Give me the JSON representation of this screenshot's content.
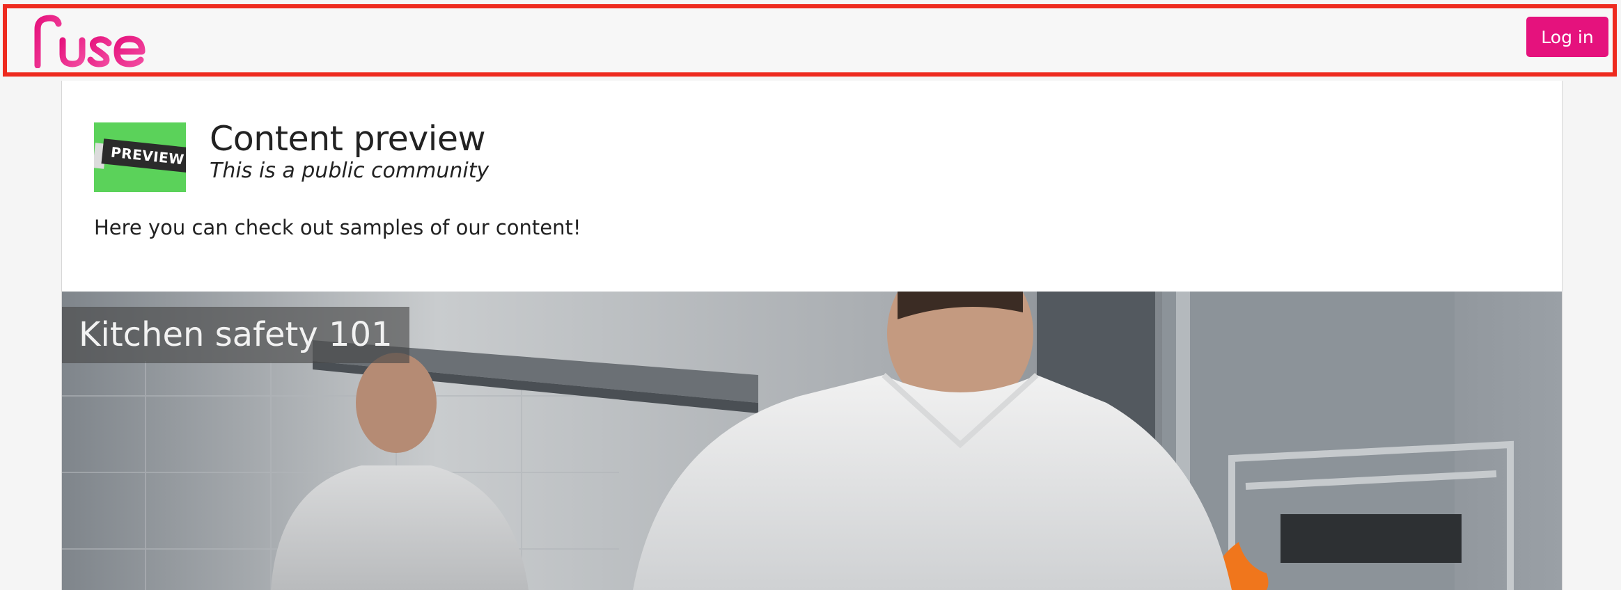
{
  "header": {
    "logo_text": "Fuse",
    "login_label": "Log in"
  },
  "community": {
    "title": "Content preview",
    "subtitle": "This is a public community",
    "description": "Here you can check out samples of our content!",
    "thumbnail_text": "PREVIEW"
  },
  "content": {
    "title": "Kitchen safety 101"
  },
  "colors": {
    "brand_pink": "#e5127d",
    "highlight_border": "#ee2a1e",
    "thumb_green": "#5bd25a"
  }
}
